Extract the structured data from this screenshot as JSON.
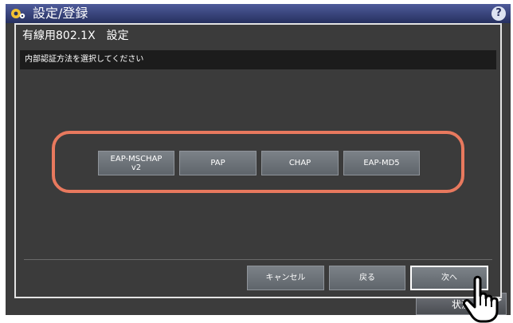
{
  "app": {
    "title": "設定/登録",
    "help_label": "?",
    "status_button_label": "状況"
  },
  "dialog": {
    "title": "有線用802.1X　設定",
    "instruction": "内部認証方法を選択してください"
  },
  "methods": [
    {
      "line1": "EAP-MSCHAP",
      "line2": "v2"
    },
    {
      "line1": "PAP",
      "line2": ""
    },
    {
      "line1": "CHAP",
      "line2": ""
    },
    {
      "line1": "EAP-MD5",
      "line2": ""
    }
  ],
  "actions": {
    "cancel_label": "キャンセル",
    "back_label": "戻る",
    "next_label": "次へ"
  },
  "colors": {
    "highlight": "#e8795e",
    "header": "#4e5b9a",
    "dialog_bg": "#3b3b3b"
  },
  "icons": [
    "gear-icon",
    "help-icon",
    "pointer-hand-icon",
    "arrow-right-icon"
  ]
}
